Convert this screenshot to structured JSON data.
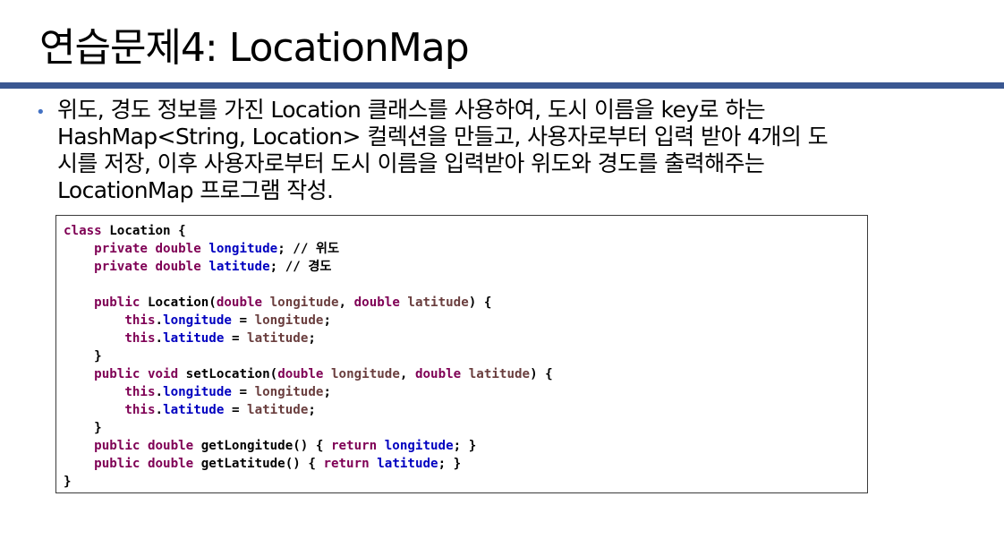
{
  "title": "연습문제4: LocationMap",
  "bullet": {
    "lines": [
      "위도, 경도 정보를 가진 Location 클래스를 사용하여, 도시 이름을 key로 하는",
      "HashMap<String, Location> 컬렉션을 만들고, 사용자로부터 입력 받아 4개의 도",
      "시를 저장, 이후 사용자로부터 도시 이름을 입력받아 위도와 경도를 출력해주는",
      "LocationMap 프로그램 작성."
    ]
  },
  "code": {
    "lines": [
      [
        {
          "t": "kw",
          "v": "class"
        },
        {
          "t": "plain",
          "v": " Location {"
        }
      ],
      [
        {
          "t": "plain",
          "v": "    "
        },
        {
          "t": "kw",
          "v": "private double"
        },
        {
          "t": "plain",
          "v": " "
        },
        {
          "t": "field",
          "v": "longitude"
        },
        {
          "t": "plain",
          "v": "; "
        },
        {
          "t": "comment",
          "v": "// 위도"
        }
      ],
      [
        {
          "t": "plain",
          "v": "    "
        },
        {
          "t": "kw",
          "v": "private double"
        },
        {
          "t": "plain",
          "v": " "
        },
        {
          "t": "field",
          "v": "latitude"
        },
        {
          "t": "plain",
          "v": "; "
        },
        {
          "t": "comment",
          "v": "// 경도"
        }
      ],
      [
        {
          "t": "plain",
          "v": " "
        }
      ],
      [
        {
          "t": "plain",
          "v": "    "
        },
        {
          "t": "kw",
          "v": "public"
        },
        {
          "t": "plain",
          "v": " Location("
        },
        {
          "t": "kw",
          "v": "double"
        },
        {
          "t": "plain",
          "v": " "
        },
        {
          "t": "param",
          "v": "longitude"
        },
        {
          "t": "plain",
          "v": ", "
        },
        {
          "t": "kw",
          "v": "double"
        },
        {
          "t": "plain",
          "v": " "
        },
        {
          "t": "param",
          "v": "latitude"
        },
        {
          "t": "plain",
          "v": ") {"
        }
      ],
      [
        {
          "t": "plain",
          "v": "        "
        },
        {
          "t": "kw",
          "v": "this"
        },
        {
          "t": "plain",
          "v": "."
        },
        {
          "t": "field",
          "v": "longitude"
        },
        {
          "t": "plain",
          "v": " = "
        },
        {
          "t": "param",
          "v": "longitude"
        },
        {
          "t": "plain",
          "v": ";"
        }
      ],
      [
        {
          "t": "plain",
          "v": "        "
        },
        {
          "t": "kw",
          "v": "this"
        },
        {
          "t": "plain",
          "v": "."
        },
        {
          "t": "field",
          "v": "latitude"
        },
        {
          "t": "plain",
          "v": " = "
        },
        {
          "t": "param",
          "v": "latitude"
        },
        {
          "t": "plain",
          "v": ";"
        }
      ],
      [
        {
          "t": "plain",
          "v": "    }"
        }
      ],
      [
        {
          "t": "plain",
          "v": "    "
        },
        {
          "t": "kw",
          "v": "public void"
        },
        {
          "t": "plain",
          "v": " setLocation("
        },
        {
          "t": "kw",
          "v": "double"
        },
        {
          "t": "plain",
          "v": " "
        },
        {
          "t": "param",
          "v": "longitude"
        },
        {
          "t": "plain",
          "v": ", "
        },
        {
          "t": "kw",
          "v": "double"
        },
        {
          "t": "plain",
          "v": " "
        },
        {
          "t": "param",
          "v": "latitude"
        },
        {
          "t": "plain",
          "v": ") {"
        }
      ],
      [
        {
          "t": "plain",
          "v": "        "
        },
        {
          "t": "kw",
          "v": "this"
        },
        {
          "t": "plain",
          "v": "."
        },
        {
          "t": "field",
          "v": "longitude"
        },
        {
          "t": "plain",
          "v": " = "
        },
        {
          "t": "param",
          "v": "longitude"
        },
        {
          "t": "plain",
          "v": ";"
        }
      ],
      [
        {
          "t": "plain",
          "v": "        "
        },
        {
          "t": "kw",
          "v": "this"
        },
        {
          "t": "plain",
          "v": "."
        },
        {
          "t": "field",
          "v": "latitude"
        },
        {
          "t": "plain",
          "v": " = "
        },
        {
          "t": "param",
          "v": "latitude"
        },
        {
          "t": "plain",
          "v": ";"
        }
      ],
      [
        {
          "t": "plain",
          "v": "    }"
        }
      ],
      [
        {
          "t": "plain",
          "v": "    "
        },
        {
          "t": "kw",
          "v": "public double"
        },
        {
          "t": "plain",
          "v": " getLongitude() { "
        },
        {
          "t": "kw",
          "v": "return"
        },
        {
          "t": "plain",
          "v": " "
        },
        {
          "t": "field",
          "v": "longitude"
        },
        {
          "t": "plain",
          "v": "; }"
        }
      ],
      [
        {
          "t": "plain",
          "v": "    "
        },
        {
          "t": "kw",
          "v": "public double"
        },
        {
          "t": "plain",
          "v": " getLatitude() { "
        },
        {
          "t": "kw",
          "v": "return"
        },
        {
          "t": "plain",
          "v": " "
        },
        {
          "t": "field",
          "v": "latitude"
        },
        {
          "t": "plain",
          "v": "; }"
        }
      ],
      [
        {
          "t": "plain",
          "v": "}"
        }
      ]
    ]
  },
  "colors": {
    "title_rule": "#3a5791",
    "bullet": "#4472c4",
    "keyword": "#7f0055",
    "field": "#0000c0",
    "parameter": "#6a3e3e"
  }
}
